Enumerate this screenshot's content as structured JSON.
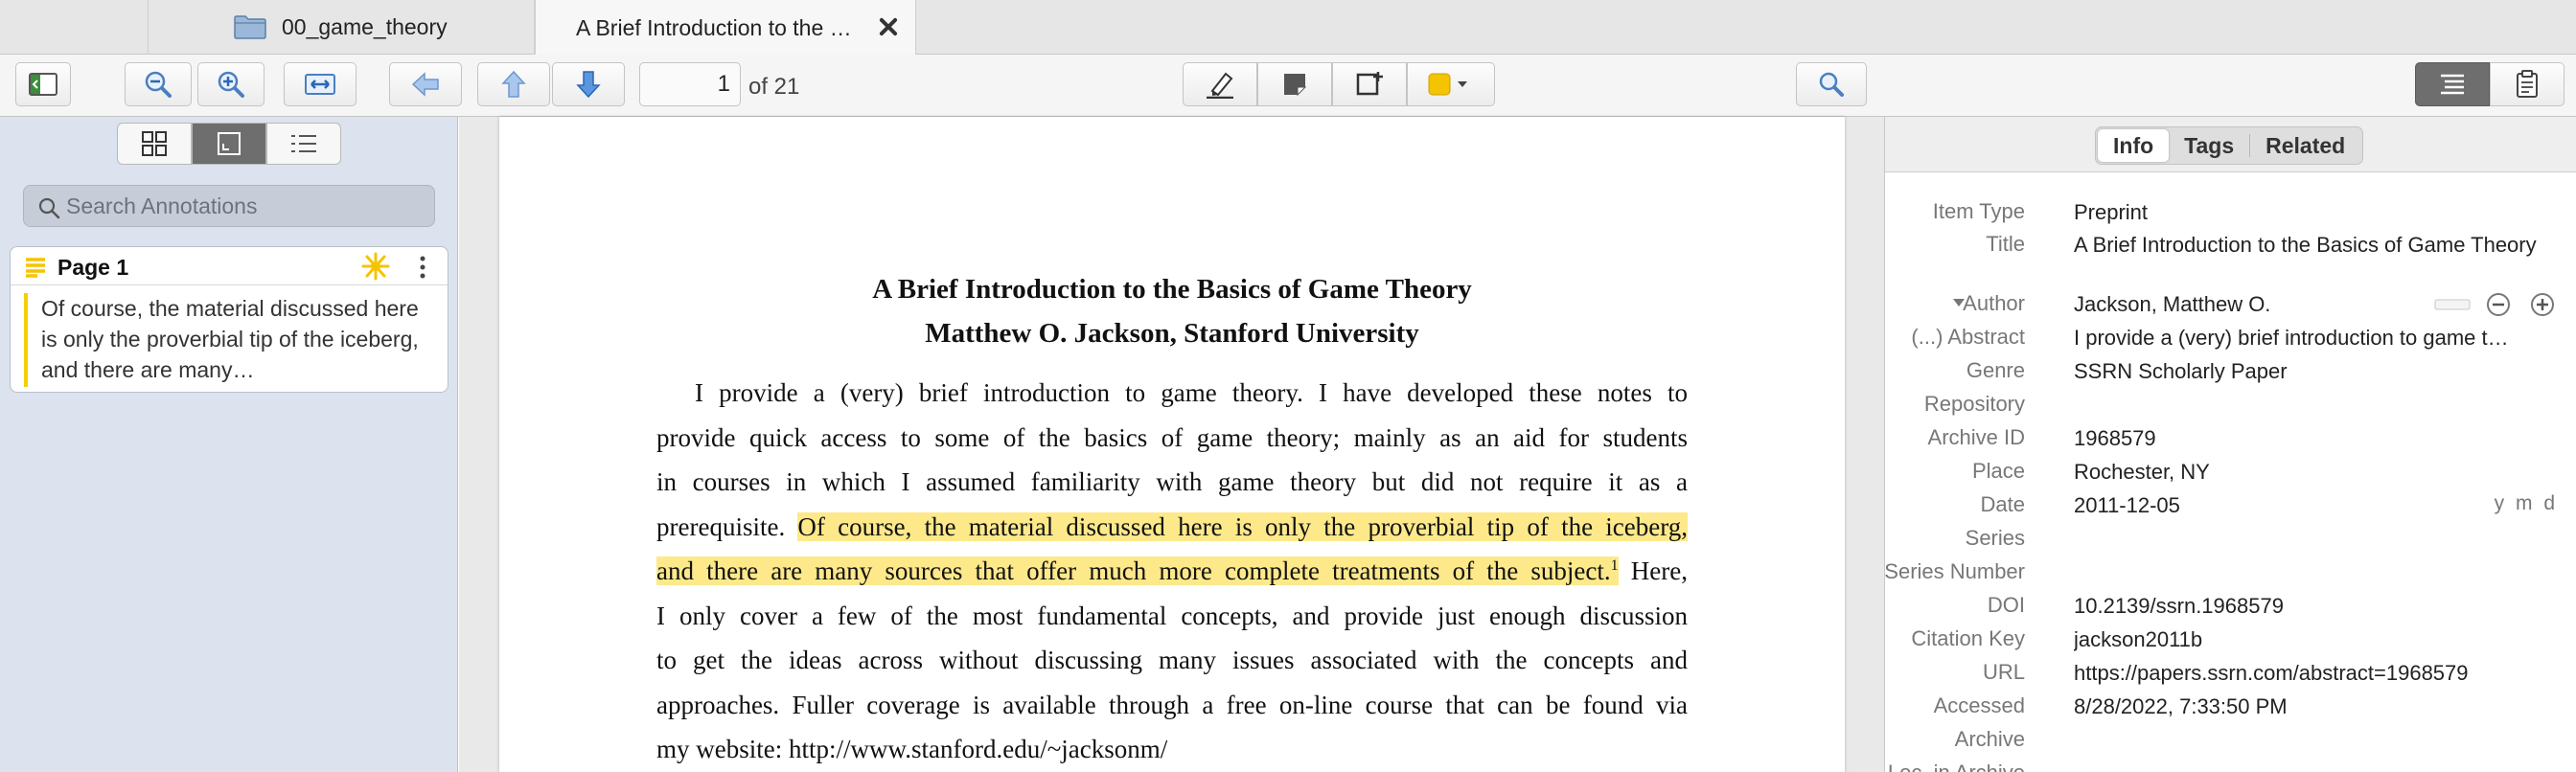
{
  "tabs": [
    {
      "label": "00_game_theory",
      "icon": "folder-icon"
    },
    {
      "label": "A Brief Introduction to the …",
      "icon": "close-icon"
    }
  ],
  "toolbar": {
    "current_page": "1",
    "page_of": "of 21",
    "highlight_color": "#f5c400"
  },
  "sidebar": {
    "search_placeholder": "Search Annotations",
    "annotation": {
      "page_label": "Page 1",
      "text": "Of course, the material discussed here is only the proverbial tip of the iceberg, and there are many…",
      "color": "#f5d000"
    }
  },
  "document": {
    "title": "A Brief Introduction to the Basics of Game Theory",
    "author": "Matthew O. Jackson, Stanford University",
    "lines": [
      {
        "text": "I provide a (very) brief introduction to game theory.  I have developed these notes to"
      },
      {
        "text": "provide quick access to some of the basics of game theory; mainly as an aid for students"
      },
      {
        "text": "in courses in which I assumed familiarity with game theory but did not require it as a"
      },
      {
        "pre": "prerequisite. ",
        "hl": "Of course, the material discussed here is only the proverbial tip of the iceberg,"
      },
      {
        "hl": "and there are many sources that offer much more complete treatments of the subject.",
        "sup": "1",
        "post": " Here,"
      },
      {
        "text": "I only cover a few of the most fundamental concepts, and provide just enough discussion"
      },
      {
        "text": "to get the ideas across without discussing many issues associated with the concepts and"
      },
      {
        "text": "approaches. Fuller coverage is available through a free on-line course that can be found via"
      },
      {
        "text": "my website: http://www.stanford.edu/~jacksonm/"
      }
    ]
  },
  "info": {
    "tabs": [
      "Info",
      "Tags",
      "Related"
    ],
    "fields": [
      {
        "label": "Item Type",
        "value": "Preprint"
      },
      {
        "label": "Title",
        "value": "A Brief Introduction to the Basics of Game Theory"
      },
      {
        "label": "Author",
        "value": "Jackson, Matthew O."
      },
      {
        "label": "(...) Abstract",
        "value": "I provide a (very) brief introduction to game t…"
      },
      {
        "label": "Genre",
        "value": "SSRN Scholarly Paper"
      },
      {
        "label": "Repository",
        "value": ""
      },
      {
        "label": "Archive ID",
        "value": "1968579"
      },
      {
        "label": "Place",
        "value": "Rochester, NY"
      },
      {
        "label": "Date",
        "value": "2011-12-05",
        "extra": "y m d"
      },
      {
        "label": "Series",
        "value": ""
      },
      {
        "label": "Series Number",
        "value": ""
      },
      {
        "label": "DOI",
        "value": "10.2139/ssrn.1968579"
      },
      {
        "label": "Citation Key",
        "value": "jackson2011b"
      },
      {
        "label": "URL",
        "value": "https://papers.ssrn.com/abstract=1968579"
      },
      {
        "label": "Accessed",
        "value": "8/28/2022, 7:33:50 PM"
      },
      {
        "label": "Archive",
        "value": ""
      },
      {
        "label": "Loc. in Archive",
        "value": ""
      }
    ]
  }
}
